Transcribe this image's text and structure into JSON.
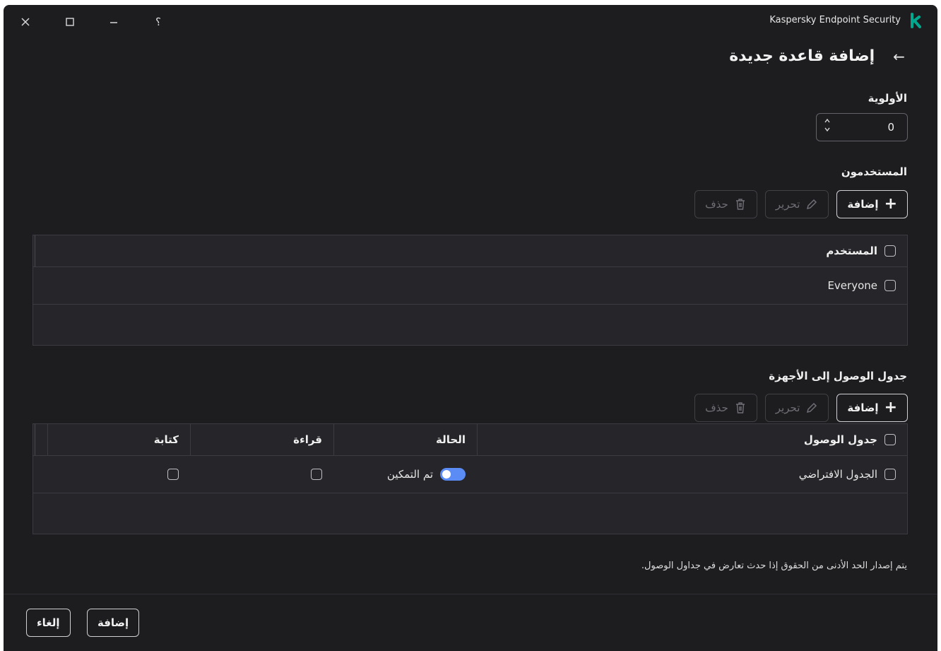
{
  "window": {
    "app_title": "Kaspersky Endpoint Security",
    "logo_letter": "k",
    "logo_color": "#00a88e",
    "controls": [
      "close-icon",
      "maximize-icon",
      "minimize-icon",
      "help-icon"
    ],
    "help_glyph": "؟"
  },
  "page": {
    "title": "إضافة قاعدة جديدة",
    "back_icon": "arrow-right-icon",
    "back_glyph": "→"
  },
  "priority": {
    "label": "الأولوية",
    "value": "0"
  },
  "users": {
    "label": "المستخدمون",
    "toolbar": {
      "add": "إضافة",
      "edit": "تحرير",
      "delete": "حذف"
    },
    "header": "المستخدم",
    "rows": [
      "Everyone"
    ]
  },
  "access_table": {
    "label": "جدول الوصول إلى الأجهزة",
    "toolbar": {
      "add": "إضافة",
      "edit": "تحرير",
      "delete": "حذف"
    },
    "columns": {
      "schedule": "جدول الوصول",
      "status": "الحالة",
      "read": "قراءة",
      "write": "كتابة"
    },
    "rows": [
      {
        "schedule": "الجدول الافتراضي",
        "status": "تم التمكين",
        "enabled": true,
        "read": false,
        "write": false
      }
    ]
  },
  "note": "يتم إصدار الحد الأدنى من الحقوق إذا حدث تعارض في جداول الوصول.",
  "footer": {
    "add": "إضافة",
    "cancel": "إلغاء"
  },
  "colors": {
    "background": "#1d1d20",
    "table": "#26262a",
    "toggle_on": "#5b8cf5"
  }
}
